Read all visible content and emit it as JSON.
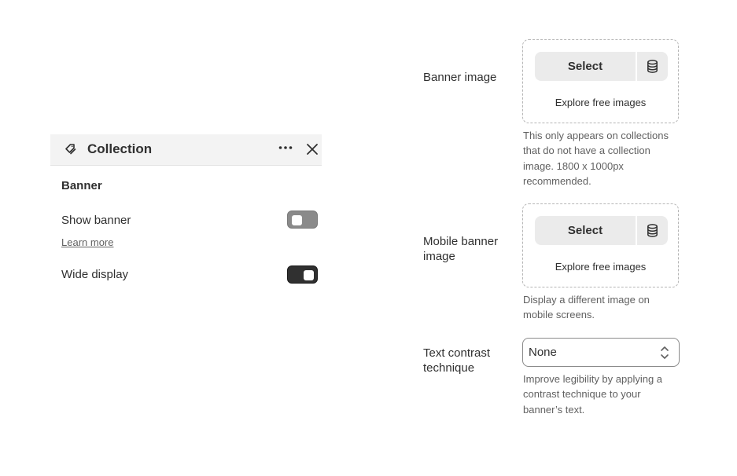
{
  "panel": {
    "title": "Collection",
    "section_title": "Banner",
    "show_banner_label": "Show banner",
    "show_banner_on": false,
    "learn_more": "Learn more",
    "wide_display_label": "Wide display",
    "wide_display_on": true,
    "icons": {
      "title": "tag-icon",
      "more": "more-dots-icon",
      "close": "close-icon"
    }
  },
  "fields": {
    "banner_image": {
      "label": "Banner image",
      "select_label": "Select",
      "explore_label": "Explore free images",
      "help": "This only appears on collections that do not have a collection image. 1800 x 1000px recommended."
    },
    "mobile_banner_image": {
      "label": "Mobile banner image",
      "select_label": "Select",
      "explore_label": "Explore free images",
      "help": "Display a different image on mobile screens."
    },
    "text_contrast": {
      "label": "Text contrast technique",
      "value": "None",
      "help": "Improve legibility by applying a contrast technique to your banner’s text."
    }
  },
  "colors": {
    "text": "#303030",
    "muted": "#616161",
    "toggle_on": "#303030",
    "toggle_off": "#8a8a8a",
    "button_bg": "#ebebeb"
  }
}
